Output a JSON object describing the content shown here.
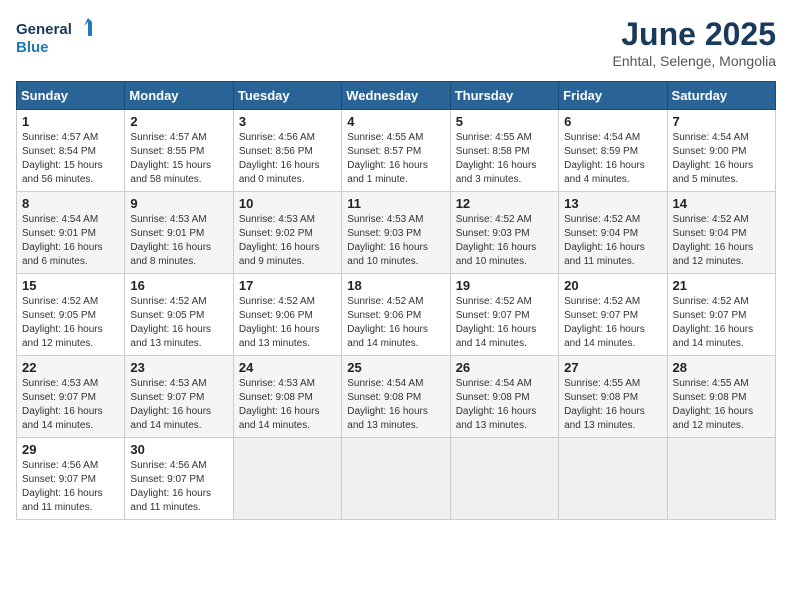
{
  "header": {
    "logo_line1": "General",
    "logo_line2": "Blue",
    "month": "June 2025",
    "location": "Enhtal, Selenge, Mongolia"
  },
  "weekdays": [
    "Sunday",
    "Monday",
    "Tuesday",
    "Wednesday",
    "Thursday",
    "Friday",
    "Saturday"
  ],
  "weeks": [
    [
      {
        "day": 1,
        "info": "Sunrise: 4:57 AM\nSunset: 8:54 PM\nDaylight: 15 hours\nand 56 minutes."
      },
      {
        "day": 2,
        "info": "Sunrise: 4:57 AM\nSunset: 8:55 PM\nDaylight: 15 hours\nand 58 minutes."
      },
      {
        "day": 3,
        "info": "Sunrise: 4:56 AM\nSunset: 8:56 PM\nDaylight: 16 hours\nand 0 minutes."
      },
      {
        "day": 4,
        "info": "Sunrise: 4:55 AM\nSunset: 8:57 PM\nDaylight: 16 hours\nand 1 minute."
      },
      {
        "day": 5,
        "info": "Sunrise: 4:55 AM\nSunset: 8:58 PM\nDaylight: 16 hours\nand 3 minutes."
      },
      {
        "day": 6,
        "info": "Sunrise: 4:54 AM\nSunset: 8:59 PM\nDaylight: 16 hours\nand 4 minutes."
      },
      {
        "day": 7,
        "info": "Sunrise: 4:54 AM\nSunset: 9:00 PM\nDaylight: 16 hours\nand 5 minutes."
      }
    ],
    [
      {
        "day": 8,
        "info": "Sunrise: 4:54 AM\nSunset: 9:01 PM\nDaylight: 16 hours\nand 6 minutes."
      },
      {
        "day": 9,
        "info": "Sunrise: 4:53 AM\nSunset: 9:01 PM\nDaylight: 16 hours\nand 8 minutes."
      },
      {
        "day": 10,
        "info": "Sunrise: 4:53 AM\nSunset: 9:02 PM\nDaylight: 16 hours\nand 9 minutes."
      },
      {
        "day": 11,
        "info": "Sunrise: 4:53 AM\nSunset: 9:03 PM\nDaylight: 16 hours\nand 10 minutes."
      },
      {
        "day": 12,
        "info": "Sunrise: 4:52 AM\nSunset: 9:03 PM\nDaylight: 16 hours\nand 10 minutes."
      },
      {
        "day": 13,
        "info": "Sunrise: 4:52 AM\nSunset: 9:04 PM\nDaylight: 16 hours\nand 11 minutes."
      },
      {
        "day": 14,
        "info": "Sunrise: 4:52 AM\nSunset: 9:04 PM\nDaylight: 16 hours\nand 12 minutes."
      }
    ],
    [
      {
        "day": 15,
        "info": "Sunrise: 4:52 AM\nSunset: 9:05 PM\nDaylight: 16 hours\nand 12 minutes."
      },
      {
        "day": 16,
        "info": "Sunrise: 4:52 AM\nSunset: 9:05 PM\nDaylight: 16 hours\nand 13 minutes."
      },
      {
        "day": 17,
        "info": "Sunrise: 4:52 AM\nSunset: 9:06 PM\nDaylight: 16 hours\nand 13 minutes."
      },
      {
        "day": 18,
        "info": "Sunrise: 4:52 AM\nSunset: 9:06 PM\nDaylight: 16 hours\nand 14 minutes."
      },
      {
        "day": 19,
        "info": "Sunrise: 4:52 AM\nSunset: 9:07 PM\nDaylight: 16 hours\nand 14 minutes."
      },
      {
        "day": 20,
        "info": "Sunrise: 4:52 AM\nSunset: 9:07 PM\nDaylight: 16 hours\nand 14 minutes."
      },
      {
        "day": 21,
        "info": "Sunrise: 4:52 AM\nSunset: 9:07 PM\nDaylight: 16 hours\nand 14 minutes."
      }
    ],
    [
      {
        "day": 22,
        "info": "Sunrise: 4:53 AM\nSunset: 9:07 PM\nDaylight: 16 hours\nand 14 minutes."
      },
      {
        "day": 23,
        "info": "Sunrise: 4:53 AM\nSunset: 9:07 PM\nDaylight: 16 hours\nand 14 minutes."
      },
      {
        "day": 24,
        "info": "Sunrise: 4:53 AM\nSunset: 9:08 PM\nDaylight: 16 hours\nand 14 minutes."
      },
      {
        "day": 25,
        "info": "Sunrise: 4:54 AM\nSunset: 9:08 PM\nDaylight: 16 hours\nand 13 minutes."
      },
      {
        "day": 26,
        "info": "Sunrise: 4:54 AM\nSunset: 9:08 PM\nDaylight: 16 hours\nand 13 minutes."
      },
      {
        "day": 27,
        "info": "Sunrise: 4:55 AM\nSunset: 9:08 PM\nDaylight: 16 hours\nand 13 minutes."
      },
      {
        "day": 28,
        "info": "Sunrise: 4:55 AM\nSunset: 9:08 PM\nDaylight: 16 hours\nand 12 minutes."
      }
    ],
    [
      {
        "day": 29,
        "info": "Sunrise: 4:56 AM\nSunset: 9:07 PM\nDaylight: 16 hours\nand 11 minutes."
      },
      {
        "day": 30,
        "info": "Sunrise: 4:56 AM\nSunset: 9:07 PM\nDaylight: 16 hours\nand 11 minutes."
      },
      null,
      null,
      null,
      null,
      null
    ]
  ]
}
